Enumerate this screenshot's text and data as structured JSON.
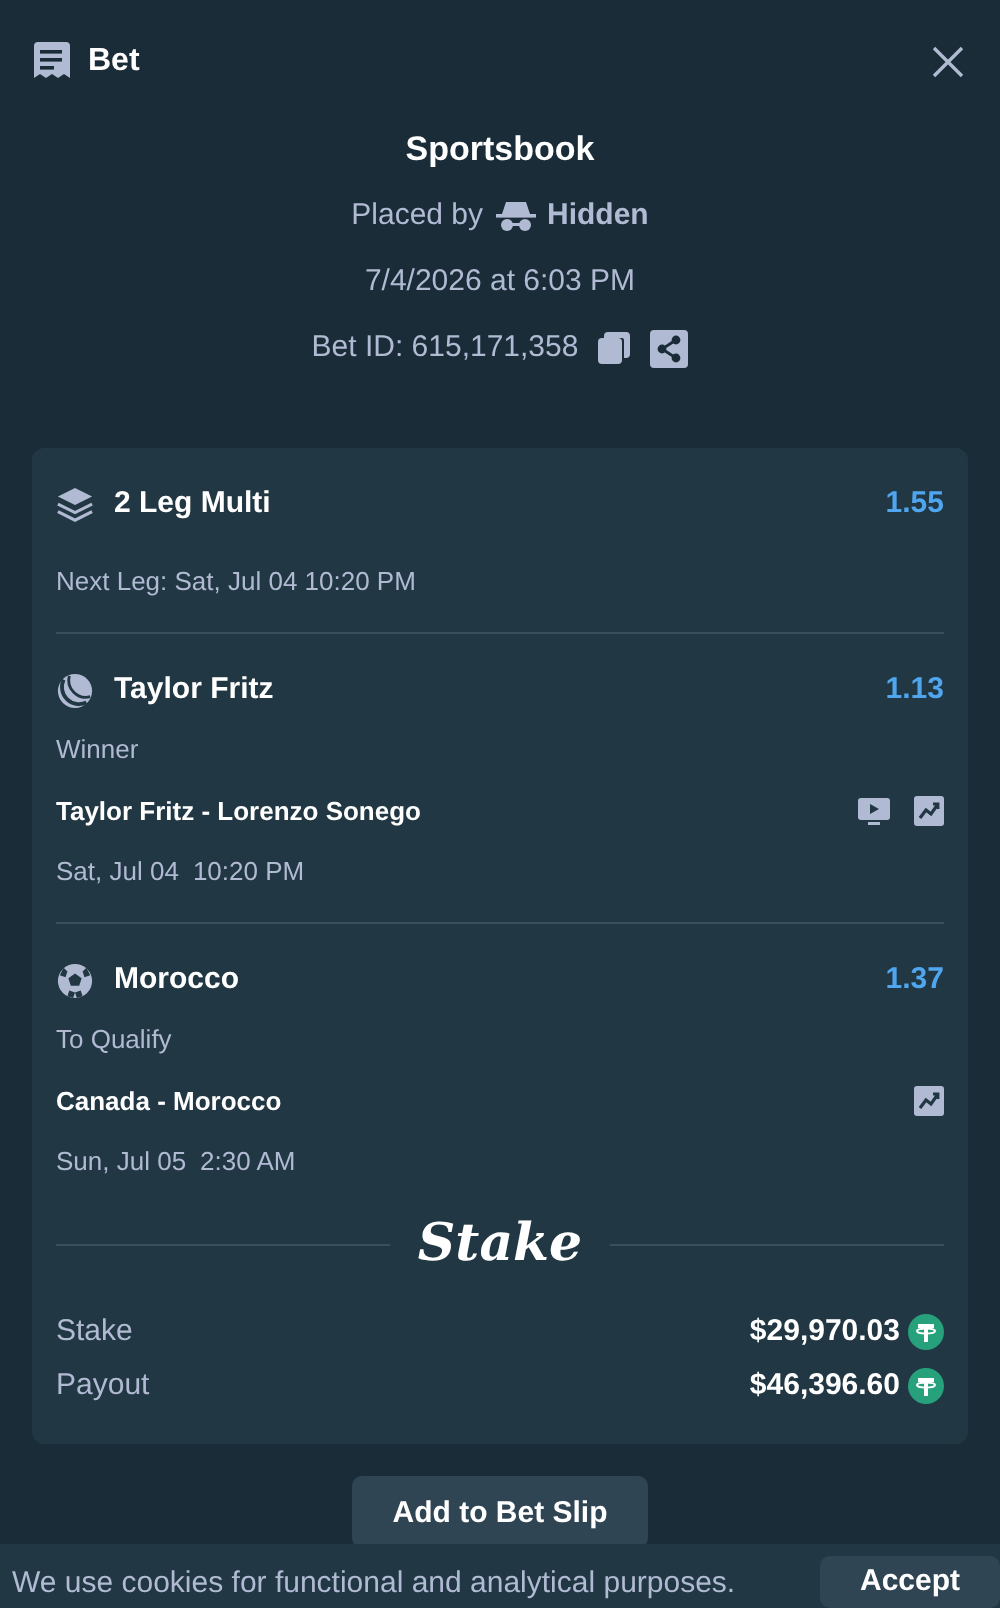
{
  "header": {
    "title": "Bet"
  },
  "summary": {
    "title": "Sportsbook",
    "placed_by_label": "Placed by",
    "user": "Hidden",
    "date": "7/4/2026 at 6:03 PM",
    "bet_id": "Bet ID: 615,171,358"
  },
  "multi": {
    "title": "2 Leg Multi",
    "odds": "1.55",
    "next_leg": "Next Leg: Sat, Jul 04 10:20 PM"
  },
  "legs": [
    {
      "kind": "tennis",
      "name": "Taylor Fritz",
      "odds": "1.13",
      "market": "Winner",
      "event": "Taylor Fritz - Lorenzo Sonego",
      "date": "Sat, Jul 04",
      "time": "10:20 PM",
      "stream": true
    },
    {
      "kind": "soccer",
      "name": "Morocco",
      "odds": "1.37",
      "market": "To Qualify",
      "event": "Canada - Morocco",
      "date": "Sun, Jul 05",
      "time": "2:30 AM",
      "stream": false
    }
  ],
  "brand": "Stake",
  "totals": [
    {
      "label": "Stake",
      "amount": "$29,970.03"
    },
    {
      "label": "Payout",
      "amount": "$46,396.60"
    }
  ],
  "add_button": "Add to Bet Slip",
  "cookie_banner": {
    "text": "We use cookies for functional and analytical purposes.",
    "button": "Accept"
  }
}
